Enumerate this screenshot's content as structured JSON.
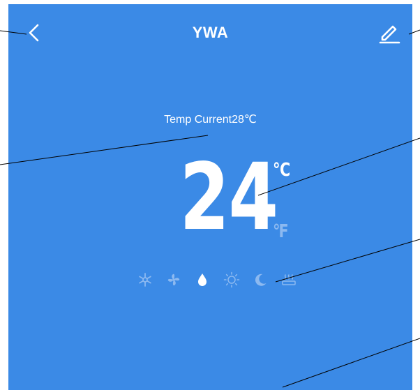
{
  "header": {
    "title": "YWA",
    "back_icon": "chevron-left-icon",
    "edit_icon": "pencil-icon"
  },
  "thermostat": {
    "current_temp_label": "Temp Current28℃",
    "set_temp": "24",
    "unit_c": "℃",
    "unit_f": "℉",
    "selected_unit": "C"
  },
  "modes": {
    "items": [
      "snowflake-icon",
      "fan-icon",
      "water-drop-icon",
      "sun-icon",
      "moon-icon",
      "heater-icon"
    ],
    "selected": "water-drop-icon"
  },
  "colors": {
    "background": "#3b8ae6",
    "active": "#ffffff",
    "inactive": "#8cb9f0"
  }
}
